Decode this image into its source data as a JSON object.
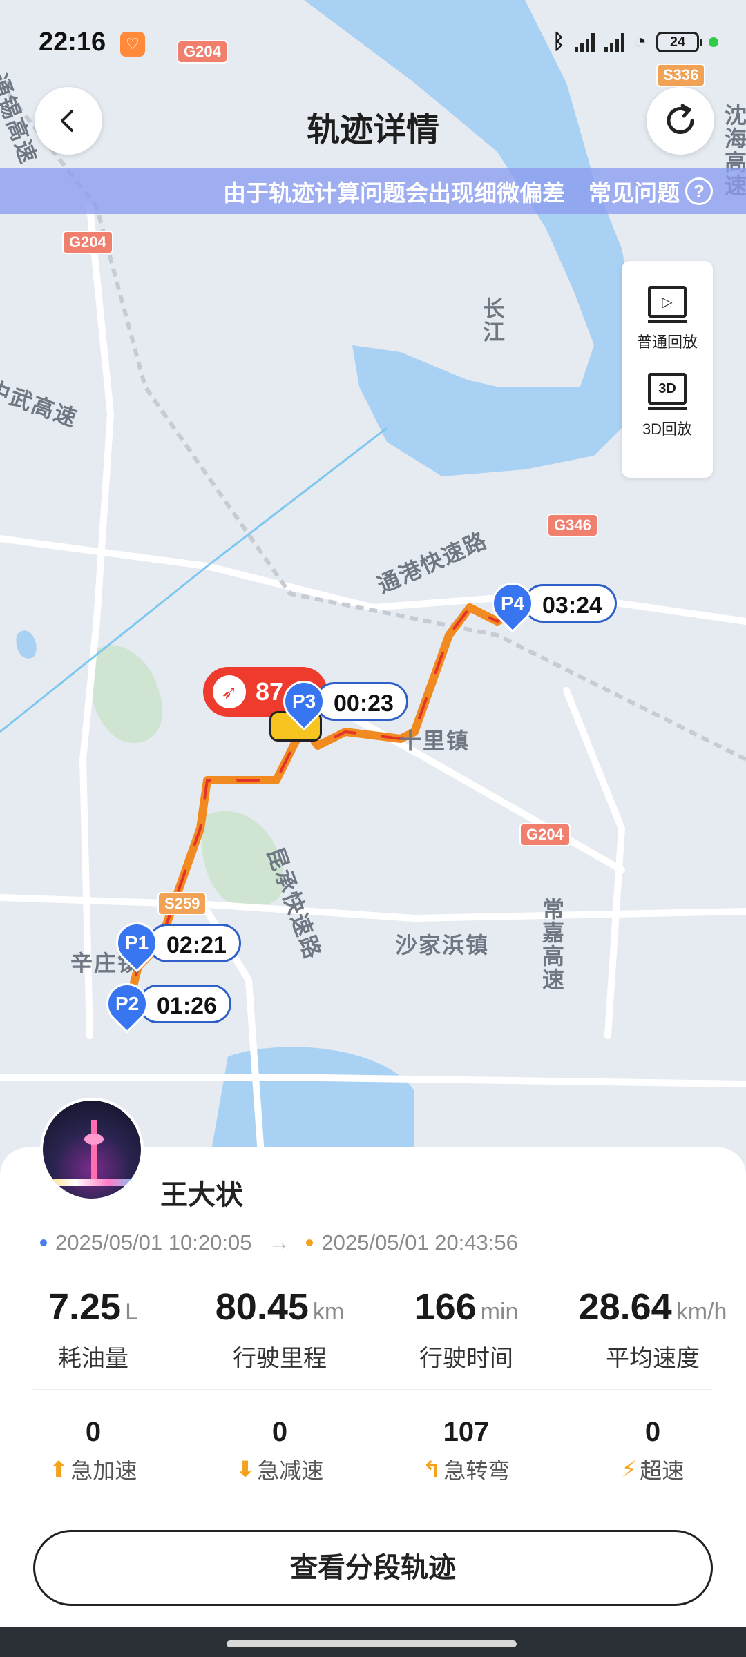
{
  "status_bar": {
    "time": "22:16",
    "battery": "24"
  },
  "header": {
    "title": "轨迹详情"
  },
  "notice": {
    "text": "由于轨迹计算问题会出现细微偏差",
    "faq_label": "常见问题"
  },
  "playback": {
    "normal_label": "普通回放",
    "three_d_label": "3D回放",
    "three_d_icon_text": "3D"
  },
  "map": {
    "labels": [
      "长江",
      "通港快速路",
      "中武高速",
      "十里镇",
      "昆承快速路",
      "沙家浜镇",
      "常嘉高速",
      "辛庄镇",
      "沈海高速",
      "通锡高速"
    ],
    "shields": [
      "G204",
      "G204",
      "S336",
      "G346",
      "G204",
      "S259"
    ],
    "speed_value": "87",
    "markers": [
      {
        "id": "P1",
        "time": "02:21"
      },
      {
        "id": "P2",
        "time": "01:26"
      },
      {
        "id": "P3",
        "time": "00:23"
      },
      {
        "id": "P4",
        "time": "03:24"
      }
    ]
  },
  "trip": {
    "user_name": "王大状",
    "start_time": "2025/05/01 10:20:05",
    "end_time": "2025/05/01 20:43:56",
    "start_dot_color": "#4a7df0",
    "end_dot_color": "#f4a11d",
    "stats": [
      {
        "value": "7.25",
        "unit": "L",
        "label": "耗油量"
      },
      {
        "value": "80.45",
        "unit": "km",
        "label": "行驶里程"
      },
      {
        "value": "166",
        "unit": "min",
        "label": "行驶时间"
      },
      {
        "value": "28.64",
        "unit": "km/h",
        "label": "平均速度"
      }
    ],
    "events": [
      {
        "count": "0",
        "label": "急加速",
        "icon": "rapid-accel-icon"
      },
      {
        "count": "0",
        "label": "急减速",
        "icon": "rapid-decel-icon"
      },
      {
        "count": "107",
        "label": "急转弯",
        "icon": "sharp-turn-icon"
      },
      {
        "count": "0",
        "label": "超速",
        "icon": "speeding-icon"
      }
    ],
    "segments_button": "查看分段轨迹"
  }
}
